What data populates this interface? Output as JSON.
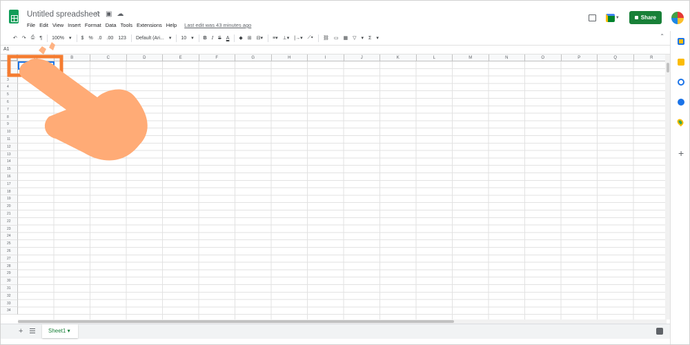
{
  "app": {
    "title": "Untitled spreadsheet",
    "last_edit": "Last edit was 43 minutes ago",
    "share_label": "Share",
    "icons": [
      "sheets-logo-icon",
      "star-icon",
      "move-to-folder-icon",
      "cloud-status-icon",
      "comment-history-icon",
      "meet-icon",
      "avatar"
    ]
  },
  "menu": [
    "File",
    "Edit",
    "View",
    "Insert",
    "Format",
    "Data",
    "Tools",
    "Extensions",
    "Help"
  ],
  "toolbar": {
    "zoom": "100%",
    "currency": "$",
    "percent": "%",
    "decrease_decimal": ".0",
    "increase_decimal": ".00",
    "more_formats": "123",
    "font": "Default (Ari...",
    "font_size": "10",
    "bold": "B",
    "italic": "I",
    "strike": "S",
    "text_color": "A",
    "functions": "Σ"
  },
  "name_box": "A1",
  "columns": [
    "A",
    "B",
    "C",
    "D",
    "E",
    "F",
    "G",
    "H",
    "I",
    "J",
    "K",
    "L",
    "M",
    "N",
    "O",
    "P",
    "Q",
    "R"
  ],
  "rows": [
    "1",
    "2",
    "3",
    "4",
    "5",
    "6",
    "7",
    "8",
    "9",
    "10",
    "11",
    "12",
    "13",
    "14",
    "15",
    "16",
    "17",
    "18",
    "19",
    "20",
    "21",
    "22",
    "23",
    "24",
    "25",
    "26",
    "27",
    "28",
    "29",
    "30",
    "31",
    "32",
    "33",
    "34"
  ],
  "sheets": [
    {
      "name": "Sheet1",
      "active": true
    }
  ],
  "colors": {
    "accent": "#188038",
    "selection": "#1a73e8",
    "highlight": "#f57c30",
    "hand": "#ffab76"
  }
}
